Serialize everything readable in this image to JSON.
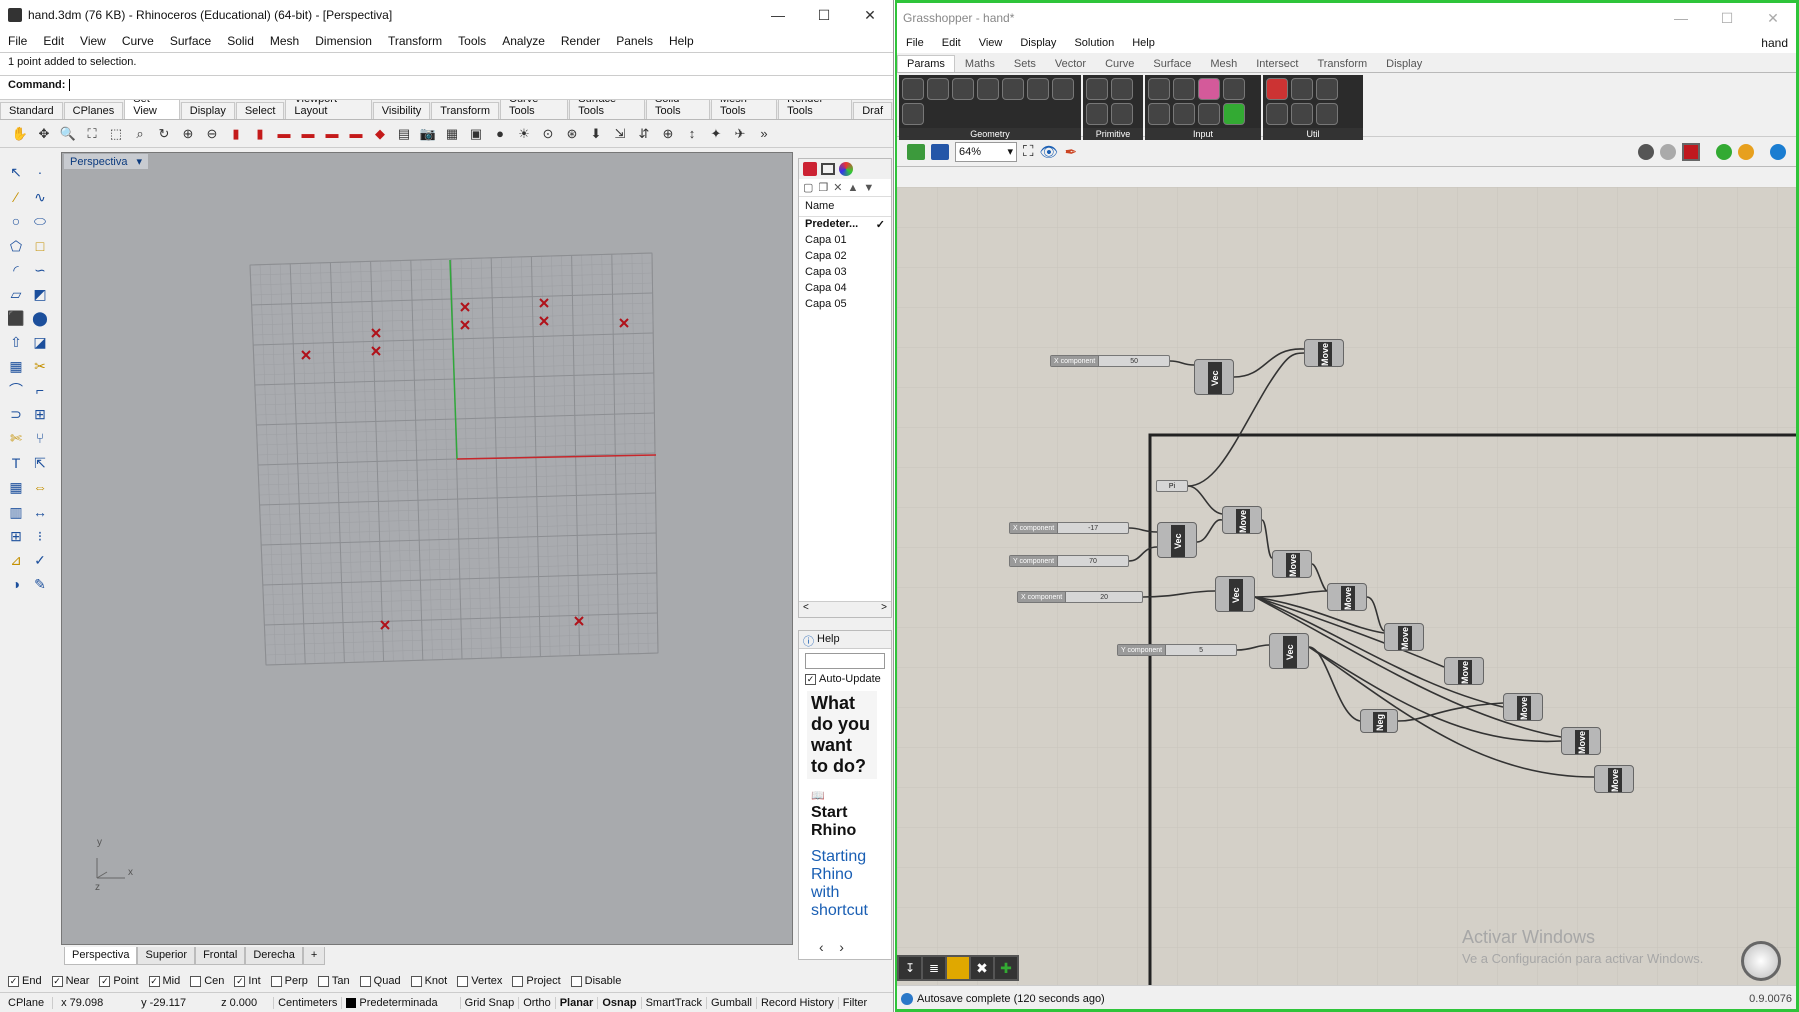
{
  "rhino": {
    "title": "hand.3dm (76 KB) - Rhinoceros (Educational) (64-bit) - [Perspectiva]",
    "menu": [
      "File",
      "Edit",
      "View",
      "Curve",
      "Surface",
      "Solid",
      "Mesh",
      "Dimension",
      "Transform",
      "Tools",
      "Analyze",
      "Render",
      "Panels",
      "Help"
    ],
    "history_line": "1 point added to selection.",
    "command_label": "Command:",
    "command_value": "",
    "toolbar_tabs": [
      "Standard",
      "CPlanes",
      "Set View",
      "Display",
      "Select",
      "Viewport Layout",
      "Visibility",
      "Transform",
      "Curve Tools",
      "Surface Tools",
      "Solid Tools",
      "Mesh Tools",
      "Render Tools",
      "Draf"
    ],
    "active_toolbar_tab": "Set View",
    "viewport_label": "Perspectiva",
    "axis_y": "y",
    "axis_z": "z",
    "axis_x": "x",
    "view_tabs": [
      "Perspectiva",
      "Superior",
      "Frontal",
      "Derecha"
    ],
    "layers": {
      "header": "Name",
      "items": [
        "Predeter...",
        "Capa 01",
        "Capa 02",
        "Capa 03",
        "Capa 04",
        "Capa 05"
      ],
      "current_mark": "✓"
    },
    "help": {
      "tab": "Help",
      "auto_update": "Auto-Update",
      "question": "What do you want to do?",
      "start_title": "Start Rhino",
      "start_link": "Starting Rhino with shortcut"
    },
    "osnaps": [
      {
        "label": "End",
        "checked": true
      },
      {
        "label": "Near",
        "checked": true
      },
      {
        "label": "Point",
        "checked": true
      },
      {
        "label": "Mid",
        "checked": true
      },
      {
        "label": "Cen",
        "checked": false
      },
      {
        "label": "Int",
        "checked": true
      },
      {
        "label": "Perp",
        "checked": false
      },
      {
        "label": "Tan",
        "checked": false
      },
      {
        "label": "Quad",
        "checked": false
      },
      {
        "label": "Knot",
        "checked": false
      },
      {
        "label": "Vertex",
        "checked": false
      },
      {
        "label": "Project",
        "checked": false
      },
      {
        "label": "Disable",
        "checked": false
      }
    ],
    "status": {
      "cplane": "CPlane",
      "x": "x 79.098",
      "y": "y -29.117",
      "z": "z 0.000",
      "units": "Centimeters",
      "layer": "Predeterminada",
      "toggles": [
        "Grid Snap",
        "Ortho",
        "Planar",
        "Osnap",
        "SmartTrack",
        "Gumball",
        "Record History",
        "Filter"
      ]
    }
  },
  "gh": {
    "title": "Grasshopper - hand*",
    "menu": [
      "File",
      "Edit",
      "View",
      "Display",
      "Solution",
      "Help"
    ],
    "doc_name": "hand",
    "tabs": [
      "Params",
      "Maths",
      "Sets",
      "Vector",
      "Curve",
      "Surface",
      "Mesh",
      "Intersect",
      "Transform",
      "Display"
    ],
    "active_tab": "Params",
    "groups": [
      "Geometry",
      "Primitive",
      "Input",
      "Util"
    ],
    "zoom": "64%",
    "status": "Autosave complete (120 seconds ago)",
    "version": "0.9.0076",
    "watermark_title": "Activar Windows",
    "watermark_sub": "Ve a Configuración para activar Windows.",
    "sliders": [
      {
        "label": "X component",
        "value": "50"
      },
      {
        "label": "X component",
        "value": "-17"
      },
      {
        "label": "Y component",
        "value": "70"
      },
      {
        "label": "X component",
        "value": "20"
      },
      {
        "label": "Y component",
        "value": "5"
      }
    ],
    "pi_label": "Pi",
    "node_labels": {
      "vec": "Vec",
      "move": "Move",
      "neg": "Neg"
    }
  }
}
